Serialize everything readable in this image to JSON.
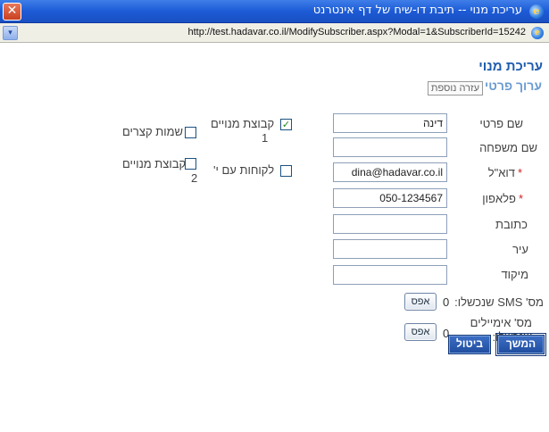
{
  "window": {
    "title": "עריכת מנוי -- תיבת דו-שיח של דף אינטרנט",
    "close_glyph": "✕",
    "url": "http://test.hadavar.co.il/ModifySubscriber.aspx?Modal=1&SubscriberId=15242",
    "dropdown_glyph": "▾",
    "browser_icon_glyph": "e"
  },
  "page": {
    "title": "עריכת מנוי",
    "section_title": "ערוך פרטי מנוי",
    "help_link": "עזרה נוספת"
  },
  "fields": {
    "first_name": {
      "label": "שם פרטי",
      "value": "דינה"
    },
    "last_name": {
      "label": "שם משפחה",
      "value": ""
    },
    "email": {
      "label": "דוא\"ל",
      "value": "dina@hadavar.co.il",
      "required": true
    },
    "mobile": {
      "label": "פלאפון",
      "value": "050-1234567",
      "required": true
    },
    "address": {
      "label": "כתובת",
      "value": ""
    },
    "city": {
      "label": "עיר",
      "value": ""
    },
    "zip": {
      "label": "מיקוד",
      "value": ""
    },
    "required_mark": "*"
  },
  "counters": {
    "sms": {
      "label": "מס' SMS שנכשלו:",
      "value": "0",
      "reset_label": "אפס"
    },
    "emails": {
      "label_line1": "מס' אימיילים",
      "label_line2": "שנכשלו:",
      "value": "0",
      "reset_label": "אפס"
    }
  },
  "groups": {
    "check_glyph": "✓",
    "items": [
      {
        "label_line1": "קבוצת מנויים",
        "label_line2": "1",
        "checked": true
      },
      {
        "label_line1": "שמות קצרים",
        "label_line2": "",
        "checked": false
      },
      {
        "label_line1": "לקוחות עם י'",
        "label_line2": "",
        "checked": false
      },
      {
        "label_line1": "קבוצת מנויים",
        "label_line2": "2",
        "checked": false
      }
    ]
  },
  "buttons": {
    "continue": "המשך",
    "cancel": "ביטול"
  }
}
